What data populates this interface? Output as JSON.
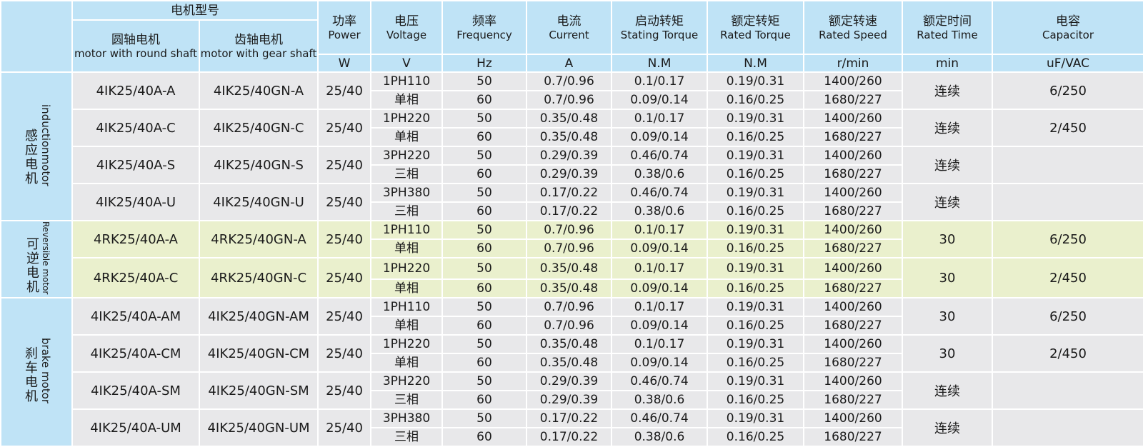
{
  "header": {
    "model_zh": "电机型号",
    "round_zh": "圆轴电机",
    "round_en": "motor with round shaft",
    "gear_zh": "齿轴电机",
    "gear_en": "motor with gear shaft",
    "power_zh": "功率",
    "power_en": "Power",
    "power_unit": "W",
    "voltage_zh": "电压",
    "voltage_en": "Voltage",
    "voltage_unit": "V",
    "freq_zh": "频率",
    "freq_en": "Frequency",
    "freq_unit": "Hz",
    "current_zh": "电流",
    "current_en": "Current",
    "current_unit": "A",
    "start_zh": "启动转矩",
    "start_en": "Stating Torque",
    "start_unit": "N.M",
    "rtorque_zh": "额定转矩",
    "rtorque_en": "Rated Torque",
    "rtorque_unit": "N.M",
    "rspeed_zh": "额定转速",
    "rspeed_en": "Rated Speed",
    "rspeed_unit": "r/min",
    "rtime_zh": "额定时间",
    "rtime_en": "Rated Time",
    "rtime_unit": "min",
    "cap_zh": "电容",
    "cap_en": "Capacitor",
    "cap_unit": "uF/VAC"
  },
  "groups": [
    {
      "name_zh": "感应电机",
      "name_en": "inductionmotor",
      "rows": [
        {
          "round": "4IK25/40A-A",
          "gear": "4IK25/40GN-A",
          "power": "25/40",
          "v1": "1PH110",
          "v2": "单相",
          "f1": "50",
          "f2": "60",
          "c1": "0.7/0.96",
          "c2": "0.7/0.96",
          "s1": "0.1/0.17",
          "s2": "0.09/0.14",
          "t1": "0.19/0.31",
          "t2": "0.16/0.25",
          "r1": "1400/260",
          "r2": "1680/227",
          "time": "连续",
          "cap": "6/250"
        },
        {
          "round": "4IK25/40A-C",
          "gear": "4IK25/40GN-C",
          "power": "25/40",
          "v1": "1PH220",
          "v2": "单相",
          "f1": "50",
          "f2": "60",
          "c1": "0.35/0.48",
          "c2": "0.35/0.48",
          "s1": "0.1/0.17",
          "s2": "0.09/0.14",
          "t1": "0.19/0.31",
          "t2": "0.16/0.25",
          "r1": "1400/260",
          "r2": "1680/227",
          "time": "连续",
          "cap": "2/450"
        },
        {
          "round": "4IK25/40A-S",
          "gear": "4IK25/40GN-S",
          "power": "25/40",
          "v1": "3PH220",
          "v2": "三相",
          "f1": "50",
          "f2": "60",
          "c1": "0.29/0.39",
          "c2": "0.29/0.39",
          "s1": "0.46/0.74",
          "s2": "0.38/0.6",
          "t1": "0.19/0.31",
          "t2": "0.16/0.25",
          "r1": "1400/260",
          "r2": "1680/227",
          "time": "连续",
          "cap": ""
        },
        {
          "round": "4IK25/40A-U",
          "gear": "4IK25/40GN-U",
          "power": "25/40",
          "v1": "3PH380",
          "v2": "三相",
          "f1": "50",
          "f2": "60",
          "c1": "0.17/0.22",
          "c2": "0.17/0.22",
          "s1": "0.46/0.74",
          "s2": "0.38/0.6",
          "t1": "0.19/0.31",
          "t2": "0.16/0.25",
          "r1": "1400/260",
          "r2": "1680/227",
          "time": "连续",
          "cap": ""
        }
      ]
    },
    {
      "name_zh": "可逆电机",
      "name_en": "Reversible motor",
      "rows": [
        {
          "round": "4RK25/40A-A",
          "gear": "4RK25/40GN-A",
          "power": "25/40",
          "v1": "1PH110",
          "v2": "单相",
          "f1": "50",
          "f2": "60",
          "c1": "0.7/0.96",
          "c2": "0.7/0.96",
          "s1": "0.1/0.17",
          "s2": "0.09/0.14",
          "t1": "0.19/0.31",
          "t2": "0.16/0.25",
          "r1": "1400/260",
          "r2": "1680/227",
          "time": "30",
          "cap": "6/250"
        },
        {
          "round": "4RK25/40A-C",
          "gear": "4RK25/40GN-C",
          "power": "25/40",
          "v1": "1PH220",
          "v2": "单相",
          "f1": "50",
          "f2": "60",
          "c1": "0.35/0.48",
          "c2": "0.35/0.48",
          "s1": "0.1/0.17",
          "s2": "0.09/0.14",
          "t1": "0.19/0.31",
          "t2": "0.16/0.25",
          "r1": "1400/260",
          "r2": "1680/227",
          "time": "30",
          "cap": "2/450"
        }
      ]
    },
    {
      "name_zh": "刹车电机",
      "name_en": "brake motor",
      "rows": [
        {
          "round": "4IK25/40A-AM",
          "gear": "4IK25/40GN-AM",
          "power": "25/40",
          "v1": "1PH110",
          "v2": "单相",
          "f1": "50",
          "f2": "60",
          "c1": "0.7/0.96",
          "c2": "0.7/0.96",
          "s1": "0.1/0.17",
          "s2": "0.09/0.14",
          "t1": "0.19/0.31",
          "t2": "0.16/0.25",
          "r1": "1400/260",
          "r2": "1680/227",
          "time": "30",
          "cap": "6/250"
        },
        {
          "round": "4IK25/40A-CM",
          "gear": "4IK25/40GN-CM",
          "power": "25/40",
          "v1": "1PH220",
          "v2": "单相",
          "f1": "50",
          "f2": "60",
          "c1": "0.35/0.48",
          "c2": "0.35/0.48",
          "s1": "0.1/0.17",
          "s2": "0.09/0.14",
          "t1": "0.19/0.31",
          "t2": "0.16/0.25",
          "r1": "1400/260",
          "r2": "1680/227",
          "time": "30",
          "cap": "2/450"
        },
        {
          "round": "4IK25/40A-SM",
          "gear": "4IK25/40GN-SM",
          "power": "25/40",
          "v1": "3PH220",
          "v2": "三相",
          "f1": "50",
          "f2": "60",
          "c1": "0.29/0.39",
          "c2": "0.29/0.39",
          "s1": "0.46/0.74",
          "s2": "0.38/0.6",
          "t1": "0.19/0.31",
          "t2": "0.16/0.25",
          "r1": "1400/260",
          "r2": "1680/227",
          "time": "连续",
          "cap": ""
        },
        {
          "round": "4IK25/40A-UM",
          "gear": "4IK25/40GN-UM",
          "power": "25/40",
          "v1": "3PH380",
          "v2": "三相",
          "f1": "50",
          "f2": "60",
          "c1": "0.17/0.22",
          "c2": "0.17/0.22",
          "s1": "0.46/0.74",
          "s2": "0.38/0.6",
          "t1": "0.19/0.31",
          "t2": "0.16/0.25",
          "r1": "1400/260",
          "r2": "1680/227",
          "time": "连续",
          "cap": ""
        }
      ]
    }
  ]
}
